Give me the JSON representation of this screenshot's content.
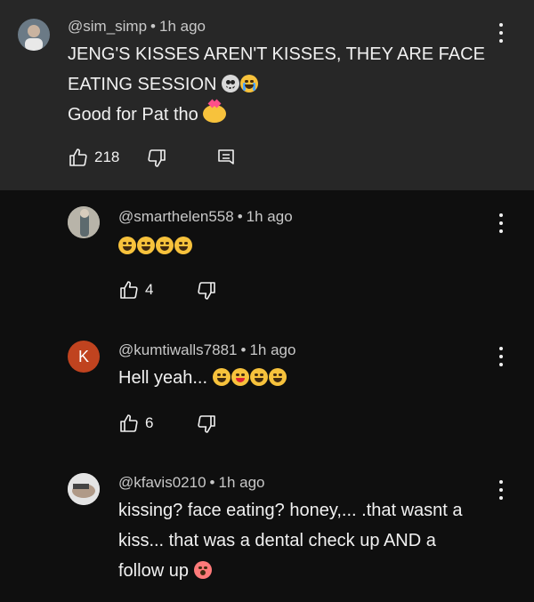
{
  "comments": [
    {
      "handle": "@sim_simp",
      "time": "1h ago",
      "lines": [
        "JENG'S KISSES AREN'T KISSES, THEY ARE FACE",
        "EATING SESSION",
        "Good for Pat tho"
      ],
      "likes": "218",
      "avatar_color": "#6b7a86"
    },
    {
      "handle": "@smarthelen558",
      "time": "1h ago",
      "lines": [
        ""
      ],
      "likes": "4",
      "avatar_color": "#9c9b95"
    },
    {
      "handle": "@kumtiwalls7881",
      "time": "1h ago",
      "lines": [
        "Hell yeah..."
      ],
      "likes": "6",
      "avatar_letter": "K",
      "avatar_color": "#c0431f"
    },
    {
      "handle": "@kfavis0210",
      "time": "1h ago",
      "lines": [
        "kissing? face eating? honey,... .that wasnt a",
        "kiss... that was  a dental check up AND a",
        "follow up"
      ],
      "avatar_color": "#cfcfcf"
    }
  ],
  "dot": "•"
}
